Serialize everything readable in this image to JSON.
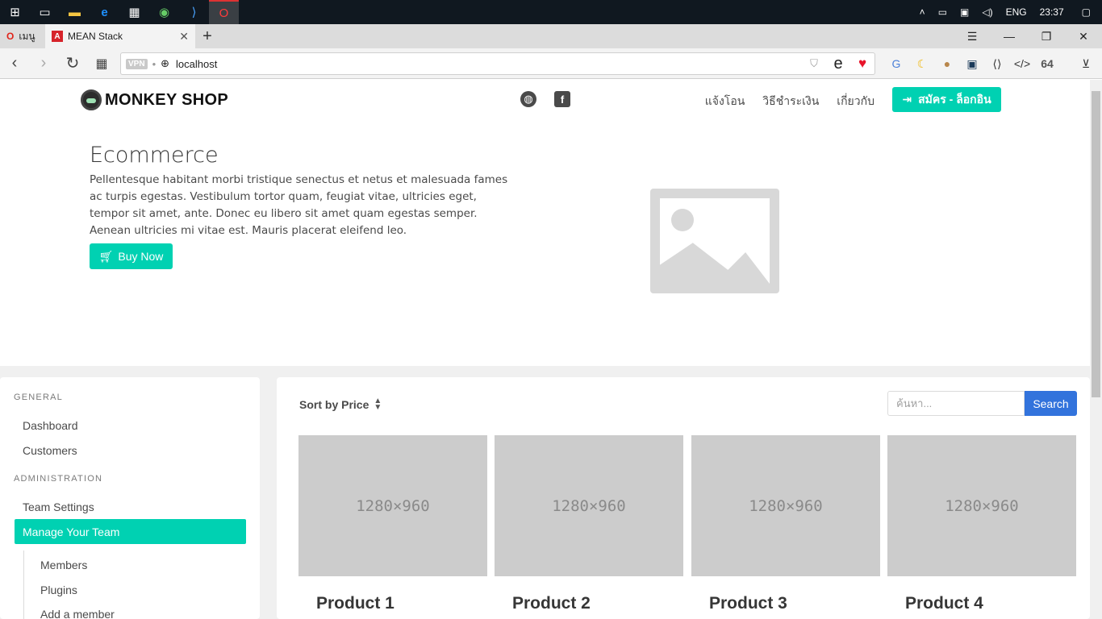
{
  "taskbar": {
    "icons": [
      "windows-start-icon",
      "task-view-icon",
      "file-explorer-icon",
      "edge-icon",
      "store-icon",
      "chrome-like-icon",
      "vscode-icon",
      "opera-icon"
    ],
    "language": "ENG",
    "time": "23:37"
  },
  "browser": {
    "menu_label": "เมนู",
    "tab_title": "MEAN Stack",
    "url": "localhost",
    "vpn_label": "VPN",
    "extension_text": "64"
  },
  "site": {
    "brand": "MONKEY SHOP",
    "nav_links": [
      "แจ้งโอน",
      "วิธีชำระเงิน",
      "เกี่ยวกับ"
    ],
    "signup_label": "สมัคร - ล็อกอิน",
    "hero_title": "Ecommerce",
    "hero_text": "Pellentesque habitant morbi tristique senectus et netus et malesuada fames ac turpis egestas. Vestibulum tortor quam, feugiat vitae, ultricies eget, tempor sit amet, ante. Donec eu libero sit amet quam egestas semper. Aenean ultricies mi vitae est. Mauris placerat eleifend leo.",
    "buy_label": "Buy Now"
  },
  "sidebar": {
    "general_label": "GENERAL",
    "admin_label": "ADMINISTRATION",
    "items": [
      "Dashboard",
      "Customers",
      "Team Settings",
      "Manage Your Team"
    ],
    "sub_items": [
      "Members",
      "Plugins",
      "Add a member"
    ]
  },
  "shop": {
    "sort_label": "Sort by Price",
    "search_placeholder": "ค้นหา...",
    "search_button": "Search",
    "products": [
      {
        "image_text": "1280×960",
        "name": "Product 1"
      },
      {
        "image_text": "1280×960",
        "name": "Product 2"
      },
      {
        "image_text": "1280×960",
        "name": "Product 3"
      },
      {
        "image_text": "1280×960",
        "name": "Product 4"
      }
    ]
  },
  "colors": {
    "primary": "#00d1b2",
    "link": "#3273dc",
    "taskbar": "#101820"
  }
}
